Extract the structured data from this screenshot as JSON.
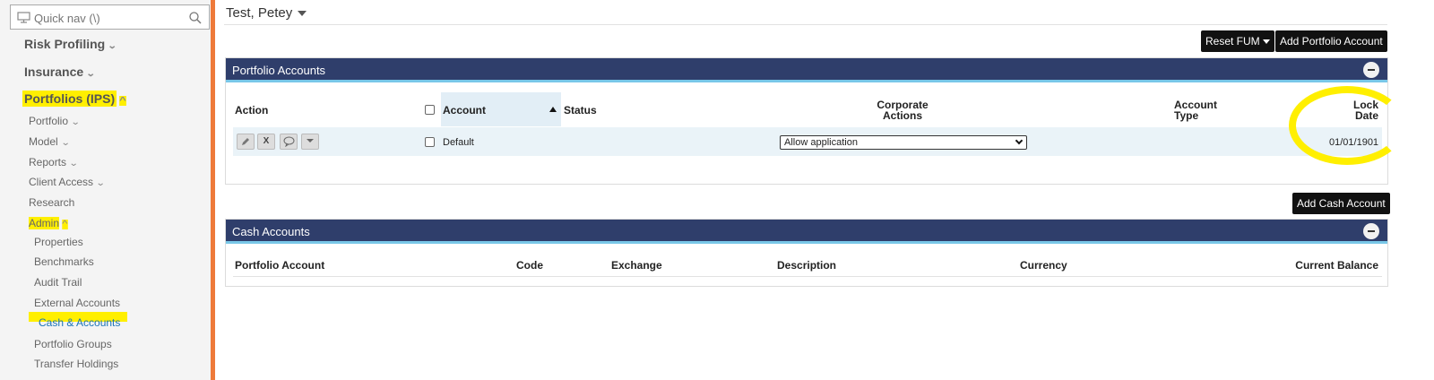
{
  "sidebar": {
    "quick_nav_placeholder": "Quick nav (\\)",
    "items": [
      {
        "label": "Risk Profiling"
      },
      {
        "label": "Insurance"
      },
      {
        "label": "Portfolios (IPS)"
      },
      {
        "label": "Portfolio"
      },
      {
        "label": "Model"
      },
      {
        "label": "Reports"
      },
      {
        "label": "Client Access"
      },
      {
        "label": "Research"
      },
      {
        "label": "Admin"
      },
      {
        "label": "Properties"
      },
      {
        "label": "Benchmarks"
      },
      {
        "label": "Audit Trail"
      },
      {
        "label": "External Accounts"
      },
      {
        "label": "Cash & Accounts"
      },
      {
        "label": "Portfolio Groups"
      },
      {
        "label": "Transfer Holdings"
      }
    ]
  },
  "header": {
    "client_name": "Test, Petey"
  },
  "buttons": {
    "reset_fum": "Reset FUM",
    "add_portfolio_account": "Add Portfolio Account",
    "add_cash_account": "Add Cash Account"
  },
  "portfolio_accounts": {
    "title": "Portfolio Accounts",
    "columns": {
      "action": "Action",
      "account": "Account",
      "status": "Status",
      "corporate_actions_1": "Corporate",
      "corporate_actions_2": "Actions",
      "account_type_1": "Account",
      "account_type_2": "Type",
      "lock_date_1": "Lock",
      "lock_date_2": "Date"
    },
    "rows": [
      {
        "account": "Default",
        "status": "",
        "corporate_actions": "Allow application",
        "account_type": "",
        "lock_date": "01/01/1901"
      }
    ],
    "action_icons": [
      "pencil-icon",
      "x-icon",
      "comment-icon",
      "dropdown-icon"
    ],
    "x_glyph": "X"
  },
  "cash_accounts": {
    "title": "Cash Accounts",
    "columns": {
      "portfolio_account": "Portfolio Account",
      "code": "Code",
      "exchange": "Exchange",
      "description": "Description",
      "currency": "Currency",
      "current_balance": "Current Balance"
    }
  },
  "colors": {
    "sidebar_accent": "#ee7a3a",
    "panel_header": "#2f3e6b",
    "highlight": "#ffef00",
    "active_link": "#1a73b8"
  }
}
